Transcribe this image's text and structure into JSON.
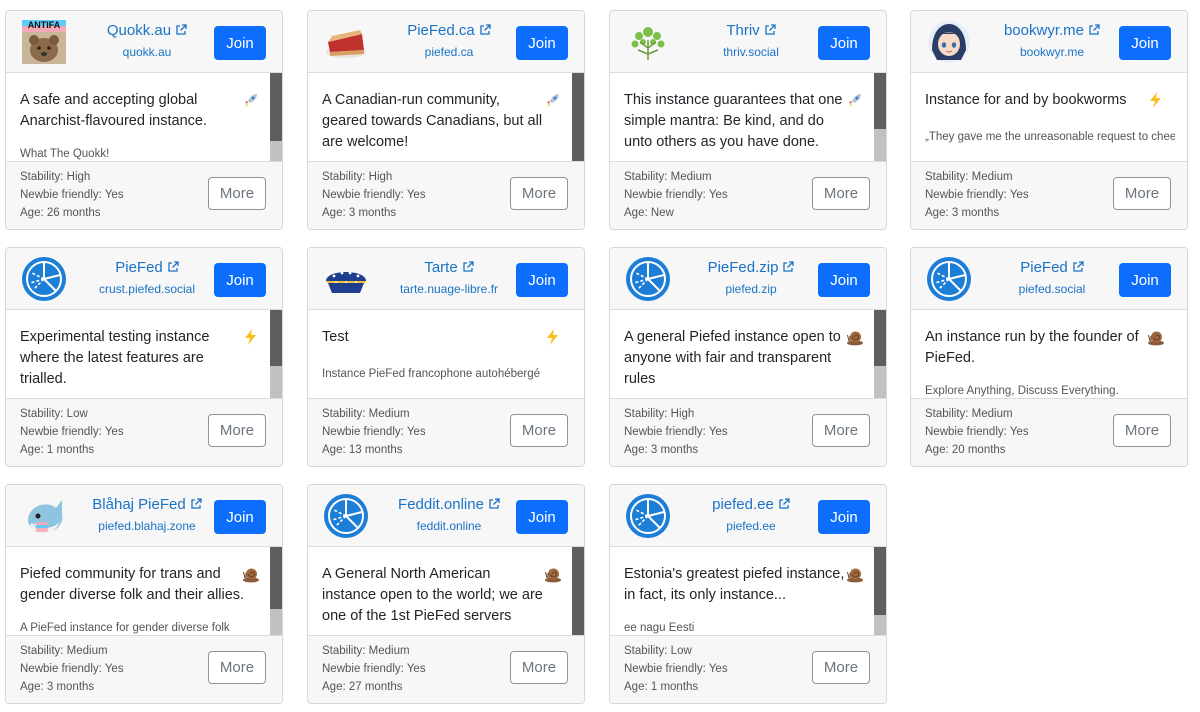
{
  "ui": {
    "join_label": "Join",
    "more_label": "More",
    "stability_prefix": "Stability: ",
    "newbie_prefix": "Newbie friendly: ",
    "age_prefix": "Age: "
  },
  "instances": [
    {
      "name": "Quokk.au",
      "domain": "quokk.au",
      "description": "A safe and accepting global Anarchist-flavoured instance.",
      "tagline": "What The Quokk!",
      "stability": "High",
      "newbie": "Yes",
      "age": "26 months",
      "speed": "rocket",
      "logo": "quokka-logo",
      "logo_text": "ANTIFA"
    },
    {
      "name": "PieFed.ca",
      "domain": "piefed.ca",
      "description": "A Canadian-run community, geared towards Canadians, but all are welcome!",
      "tagline": "",
      "stability": "High",
      "newbie": "Yes",
      "age": "3 months",
      "speed": "rocket",
      "logo": "pie-logo"
    },
    {
      "name": "Thriv",
      "domain": "thriv.social",
      "description": "This instance guarantees that one simple mantra: Be kind, and do unto others as you have done.",
      "tagline": "",
      "stability": "Medium",
      "newbie": "Yes",
      "age": "New",
      "speed": "rocket",
      "logo": "tree-logo"
    },
    {
      "name": "bookwyr.me",
      "domain": "bookwyr.me",
      "description": "Instance for and by bookworms",
      "tagline": "„They gave me the unreasonable request to cheer you up with something other",
      "stability": "Medium",
      "newbie": "Yes",
      "age": "3 months",
      "speed": "lightning",
      "logo": "avatar-logo"
    },
    {
      "name": "PieFed",
      "domain": "crust.piefed.social",
      "description": "Experimental testing instance where the latest features are trialled.",
      "tagline": "",
      "stability": "Low",
      "newbie": "Yes",
      "age": "1 months",
      "speed": "lightning",
      "logo": "piefed-logo"
    },
    {
      "name": "Tarte",
      "domain": "tarte.nuage-libre.fr",
      "description": "Test",
      "tagline": "Instance PieFed francophone autohébergé",
      "stability": "Medium",
      "newbie": "Yes",
      "age": "13 months",
      "speed": "lightning",
      "logo": "tarte-logo"
    },
    {
      "name": "PieFed.zip",
      "domain": "piefed.zip",
      "description": "A general Piefed instance open to anyone with fair and transparent rules",
      "tagline": "",
      "stability": "High",
      "newbie": "Yes",
      "age": "3 months",
      "speed": "snail",
      "logo": "piefed-logo"
    },
    {
      "name": "PieFed",
      "domain": "piefed.social",
      "description": "An instance run by the founder of PieFed.",
      "tagline": "Explore Anything, Discuss Everything.",
      "stability": "Medium",
      "newbie": "Yes",
      "age": "20 months",
      "speed": "snail",
      "logo": "piefed-logo"
    },
    {
      "name": "Blåhaj PieFed",
      "domain": "piefed.blahaj.zone",
      "description": "Piefed community for trans and gender diverse folk and their allies.",
      "tagline": "A PieFed instance for gender diverse folk",
      "stability": "Medium",
      "newbie": "Yes",
      "age": "3 months",
      "speed": "snail",
      "logo": "shark-logo"
    },
    {
      "name": "Feddit.online",
      "domain": "feddit.online",
      "description": "A General North American instance open to the world; we are one of the 1st PieFed servers",
      "tagline": "",
      "stability": "Medium",
      "newbie": "Yes",
      "age": "27 months",
      "speed": "snail",
      "logo": "piefed-logo"
    },
    {
      "name": "piefed.ee",
      "domain": "piefed.ee",
      "description": "Estonia's greatest piefed instance, in fact, its only instance...",
      "tagline": "ee nagu Eesti",
      "stability": "Low",
      "newbie": "Yes",
      "age": "1 months",
      "speed": "snail",
      "logo": "piefed-logo"
    }
  ]
}
